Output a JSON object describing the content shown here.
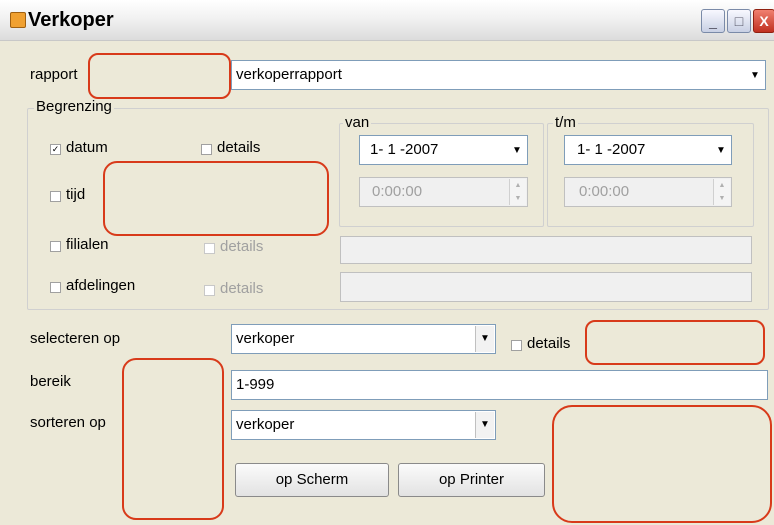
{
  "window": {
    "title": "Verkoper",
    "min_glyph": "_",
    "max_glyph": "□",
    "close_glyph": "X"
  },
  "rapport": {
    "label": "rapport",
    "value": "verkoperrapport"
  },
  "begrenzing": {
    "legend": "Begrenzing",
    "datum": {
      "label": "datum",
      "checked": true,
      "check_glyph": "✓"
    },
    "datum_details": {
      "label": "details",
      "checked": false
    },
    "tijd": {
      "label": "tijd",
      "checked": false
    },
    "van": {
      "legend": "van",
      "date": "1- 1 -2007",
      "time": "0:00:00"
    },
    "tm": {
      "legend": "t/m",
      "date": "1- 1 -2007",
      "time": "0:00:00"
    },
    "filialen": {
      "label": "filialen",
      "checked": false,
      "details_label": "details"
    },
    "afdelingen": {
      "label": "afdelingen",
      "checked": false,
      "details_label": "details"
    }
  },
  "selecteren": {
    "label": "selecteren op",
    "value": "verkoper",
    "details_label": "details"
  },
  "bereik": {
    "label": "bereik",
    "value": "1-999"
  },
  "sorteren": {
    "label": "sorteren op",
    "value": "verkoper"
  },
  "buttons": {
    "screen": "op Scherm",
    "printer": "op Printer"
  },
  "icons": {
    "dropdown": "▼",
    "spin_up": "▲",
    "spin_down": "▼"
  }
}
